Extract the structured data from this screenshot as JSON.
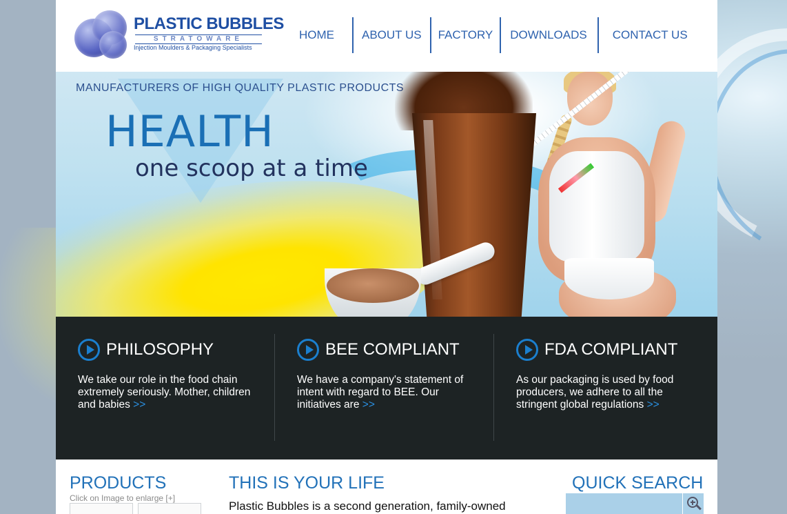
{
  "brand": {
    "name": "PLASTIC BUBBLES",
    "sub": "STRATOWARE",
    "tagline": "Injection Moulders & Packaging Specialists"
  },
  "nav": {
    "items": [
      {
        "label": "HOME"
      },
      {
        "label": "ABOUT US"
      },
      {
        "label": "FACTORY"
      },
      {
        "label": "DOWNLOADS"
      },
      {
        "label": "CONTACT US"
      }
    ]
  },
  "hero": {
    "tagline": "MANUFACTURERS OF HIGH QUALITY PLASTIC PRODUCTS",
    "title": "HEALTH",
    "subtitle": "one scoop at a time"
  },
  "features": [
    {
      "title": "PHILOSOPHY",
      "text": "We take our role in the food chain extremely seriously. Mother, children and babies",
      "more": ">>"
    },
    {
      "title": "BEE COMPLIANT",
      "text": "We have a company's statement of intent with regard to BEE. Our initiatives are",
      "more": ">>"
    },
    {
      "title": "FDA COMPLIANT",
      "text": "As our packaging is used by food producers, we adhere to all the stringent global regulations",
      "more": ">>"
    }
  ],
  "products": {
    "title": "PRODUCTS",
    "hint": "Click on Image to enlarge [+]"
  },
  "life": {
    "title": "THIS IS YOUR LIFE",
    "text": "Plastic Bubbles is a second generation, family-owned"
  },
  "search": {
    "title": "QUICK SEARCH",
    "icon": "zoom-in-icon"
  },
  "colors": {
    "accent": "#2171b8",
    "nav": "#2e62ae",
    "band": "#1d2324",
    "link": "#2a8fe0"
  }
}
